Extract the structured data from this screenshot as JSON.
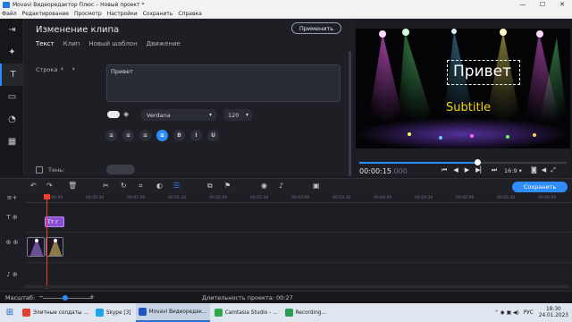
{
  "window": {
    "title": "Movavi Видеоредактор Плюс – Новый проект *",
    "minimize": "—",
    "maximize": "☐",
    "close": "✕"
  },
  "menu": [
    "Файл",
    "Редактирование",
    "Просмотр",
    "Настройки",
    "Сохранить",
    "Справка"
  ],
  "toolstrip": [
    "import-icon",
    "filters-icon",
    "titles-icon",
    "transitions-icon",
    "stickers-icon",
    "more-tools-icon"
  ],
  "editor": {
    "title": "Изменение клипа",
    "apply_label": "Применить",
    "tabs": [
      "Текст",
      "Клип",
      "Новый шаблон",
      "Движение"
    ],
    "row_label": "Строка",
    "row_prev": "‹",
    "row_next": "›",
    "text_value": "Привет",
    "font": "Verdana",
    "font_size": "120",
    "format_buttons": [
      "≡",
      "≡",
      "≡",
      "≡",
      "B",
      "I",
      "U"
    ],
    "shadow_label": "Тень:"
  },
  "preview": {
    "main_text": "Привет",
    "sub_text": "Subtitle",
    "timecode": "00:00:15",
    "timecode_ms": ".000",
    "aspect_ratio": "16:9 ▾",
    "progress_fraction": 0.57,
    "controls": [
      "⏮",
      "◀",
      "▶",
      "▶▏",
      "⏭"
    ]
  },
  "timeline_toolbar": {
    "save_label": "Сохранить"
  },
  "timeline": {
    "ticks": [
      "00:00:00",
      "00:00:30",
      "00:01:00",
      "00:01:30",
      "00:02:00",
      "00:02:30",
      "00:03:00",
      "00:03:30",
      "00:04:00",
      "00:04:30",
      "00:05:00",
      "00:05:30",
      "00:06:00"
    ],
    "title_clip": "Tт г"
  },
  "status": {
    "zoom_label": "Масштаб:",
    "duration_label": "Длительность проекта:",
    "duration_value": "00:27"
  },
  "taskbar": {
    "items": [
      {
        "label": "Элитные солдаты ...",
        "color": "#e0412e",
        "active": false
      },
      {
        "label": "Skype [3]",
        "color": "#1aa7e8",
        "active": false
      },
      {
        "label": "Movavi Видеоредак...",
        "color": "#2255c4",
        "active": true
      },
      {
        "label": "Camtasia Studio - ...",
        "color": "#2ea84a",
        "active": false
      },
      {
        "label": "Recording...",
        "color": "#2a9d55",
        "active": false
      }
    ],
    "lang": "РУС",
    "time": "18:30",
    "date": "24.01.2023"
  },
  "colors": {
    "accent": "#2f8cff",
    "title_clip": "#8a4fd0",
    "subtitle": "#f0d400",
    "playhead": "#ff3b30"
  }
}
